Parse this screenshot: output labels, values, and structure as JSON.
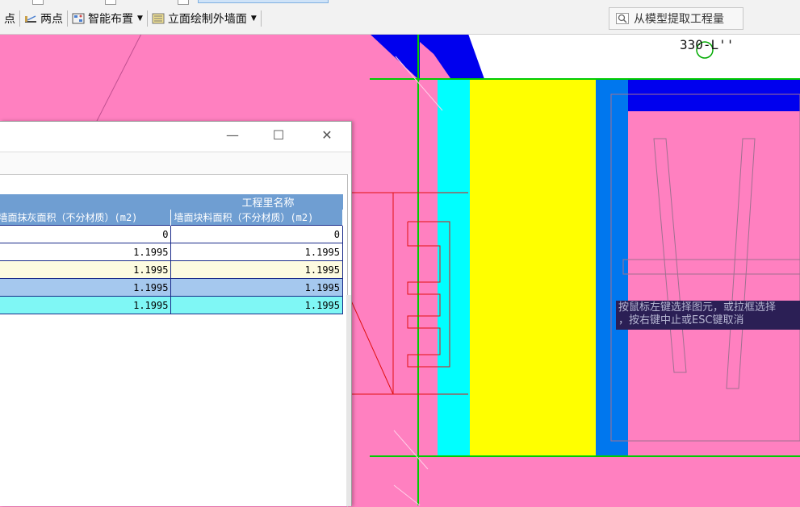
{
  "toolbar": {
    "item_point": "点",
    "item_two_points": "两点",
    "item_smart_layout": "智能布置",
    "item_elevation_wall": "立面绘制外墙面",
    "extract_quantity": "从模型提取工程量"
  },
  "canvas": {
    "grid_label": "330-L''",
    "status_tip_line1": "按鼠标左键选择图元，或拉框选择",
    "status_tip_line2": "，按右键中止或ESC键取消"
  },
  "quantity_table": {
    "group_header": "工程里名称",
    "columns": [
      "墙面抹灰面积（不分材质）(m2)",
      "墙面块料面积（不分材质）(m2)"
    ],
    "rows": [
      [
        "0",
        "0"
      ],
      [
        "1.1995",
        "1.1995"
      ],
      [
        "1.1995",
        "1.1995"
      ],
      [
        "1.1995",
        "1.1995"
      ],
      [
        "1.1995",
        "1.1995"
      ]
    ]
  },
  "colors": {
    "background_wall": "#ff80c0",
    "cyan_layer": "#00ffff",
    "yellow_layer": "#ffff00",
    "blue_layer": "#0077ee",
    "axis_green": "#00cc00"
  }
}
